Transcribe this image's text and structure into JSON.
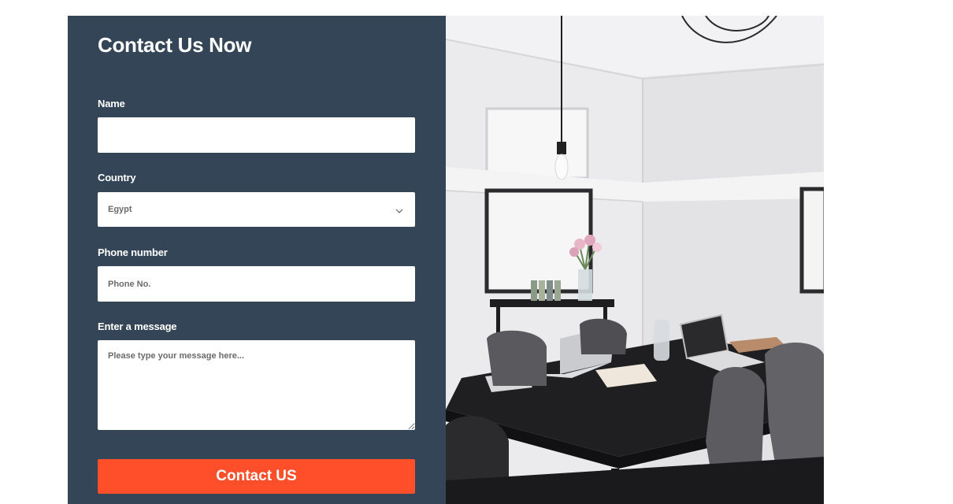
{
  "form": {
    "title": "Contact Us Now",
    "name_label": "Name",
    "name_value": "",
    "country_label": "Country",
    "country_selected": "Egypt",
    "phone_label": "Phone number",
    "phone_placeholder": "Phone No.",
    "message_label": "Enter a message",
    "message_placeholder": "Please type your message here...",
    "submit_label": "Contact US"
  },
  "colors": {
    "panel": "#344557",
    "accent": "#ff4f2a"
  },
  "icons": {
    "country_dropdown": "chevron-down-icon",
    "photo": "office-meeting-room-photo"
  }
}
